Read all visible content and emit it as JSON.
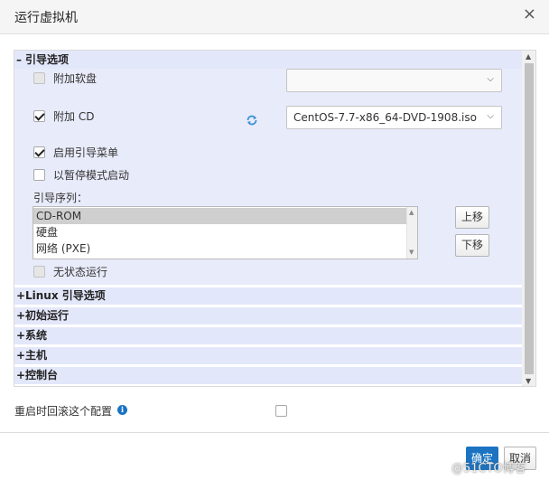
{
  "dialog": {
    "title": "运行虚拟机"
  },
  "boot": {
    "header": "引导选项",
    "attach_floppy": {
      "label": "附加软盘",
      "checked": false,
      "select_value": ""
    },
    "attach_cd": {
      "label": "附加 CD",
      "checked": true,
      "select_value": "CentOS-7.7-x86_64-DVD-1908.iso"
    },
    "enable_boot_menu": {
      "label": "启用引导菜单",
      "checked": true
    },
    "start_paused": {
      "label": "以暂停模式启动",
      "checked": false
    },
    "boot_sequence_label": "引导序列：",
    "boot_sequence": [
      "CD-ROM",
      "硬盘",
      "网络 (PXE)"
    ],
    "selected_index": 0,
    "move_up": "上移",
    "move_down": "下移",
    "stateless": {
      "label": "无状态运行",
      "checked": false
    }
  },
  "sections": [
    {
      "sign": "+",
      "label": "Linux 引导选项"
    },
    {
      "sign": "+",
      "label": "初始运行"
    },
    {
      "sign": "+",
      "label": "系统"
    },
    {
      "sign": "+",
      "label": "主机"
    },
    {
      "sign": "+",
      "label": "控制台"
    }
  ],
  "rollback": {
    "label": "重启时回滚这个配置",
    "checked": false
  },
  "footer": {
    "ok": "确定",
    "cancel": "取消"
  },
  "watermark": "@51CTO博客",
  "colors": {
    "accent": "#1b73c2",
    "section_bg": "#e3e7fa"
  }
}
